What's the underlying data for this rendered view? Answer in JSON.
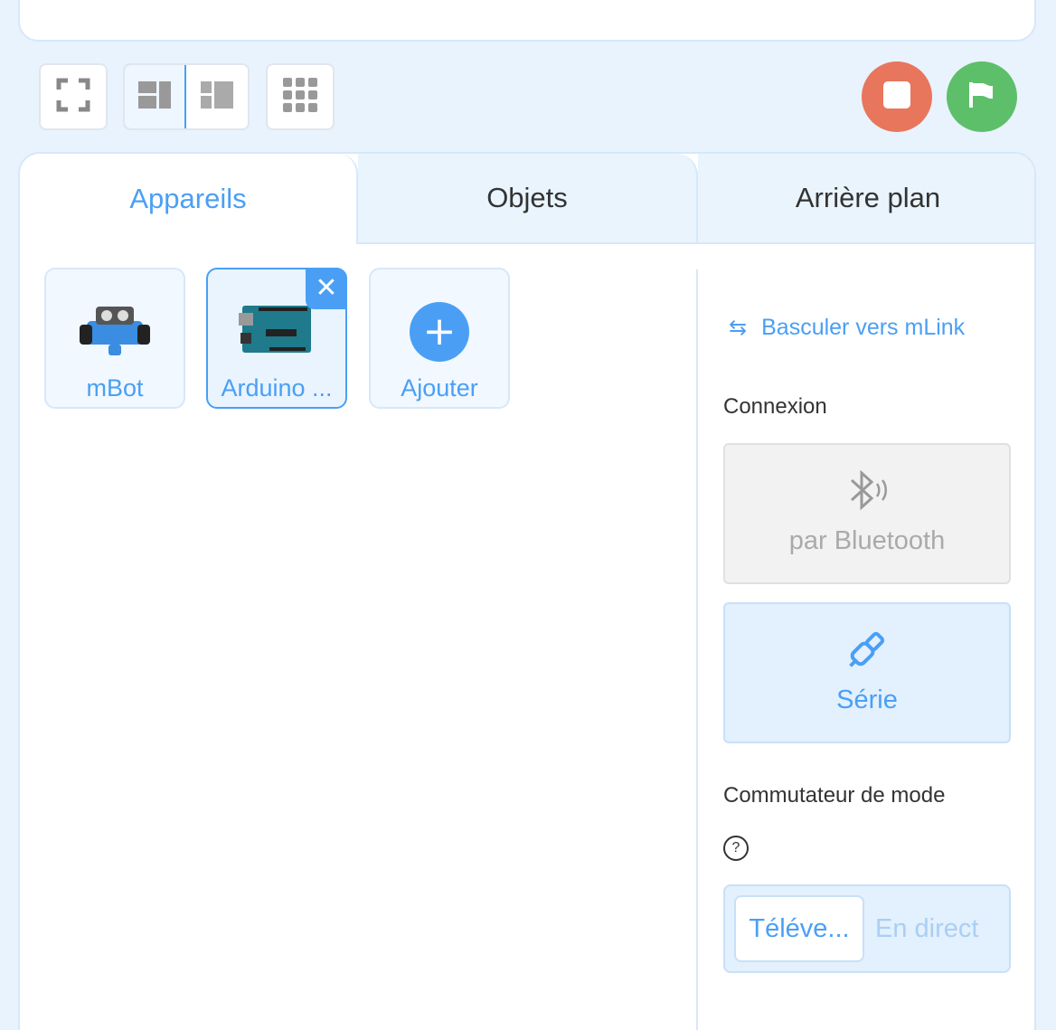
{
  "toolbar": {
    "fullscreen_icon": "fullscreen-icon",
    "layout_icons": [
      "layout-stage-large-icon",
      "layout-stage-small-icon"
    ],
    "grid_icon": "grid-icon"
  },
  "actions": {
    "stop_color": "#e8765c",
    "go_color": "#5dbf6a"
  },
  "tabs": [
    {
      "label": "Appareils"
    },
    {
      "label": "Objets"
    },
    {
      "label": "Arrière plan"
    }
  ],
  "devices": [
    {
      "label": "mBot",
      "icon": "mbot-robot-icon"
    },
    {
      "label": "Arduino ...",
      "icon": "arduino-board-icon"
    },
    {
      "label": "Ajouter",
      "icon": "add-icon"
    }
  ],
  "right_panel": {
    "mlink_label": "Basculer vers mLink",
    "connection_label": "Connexion",
    "bluetooth_label": "par Bluetooth",
    "serial_label": "Série",
    "mode_label": "Commutateur de mode",
    "mode_upload": "Téléve...",
    "mode_live": "En direct"
  },
  "accent_color": "#4a9ff5"
}
